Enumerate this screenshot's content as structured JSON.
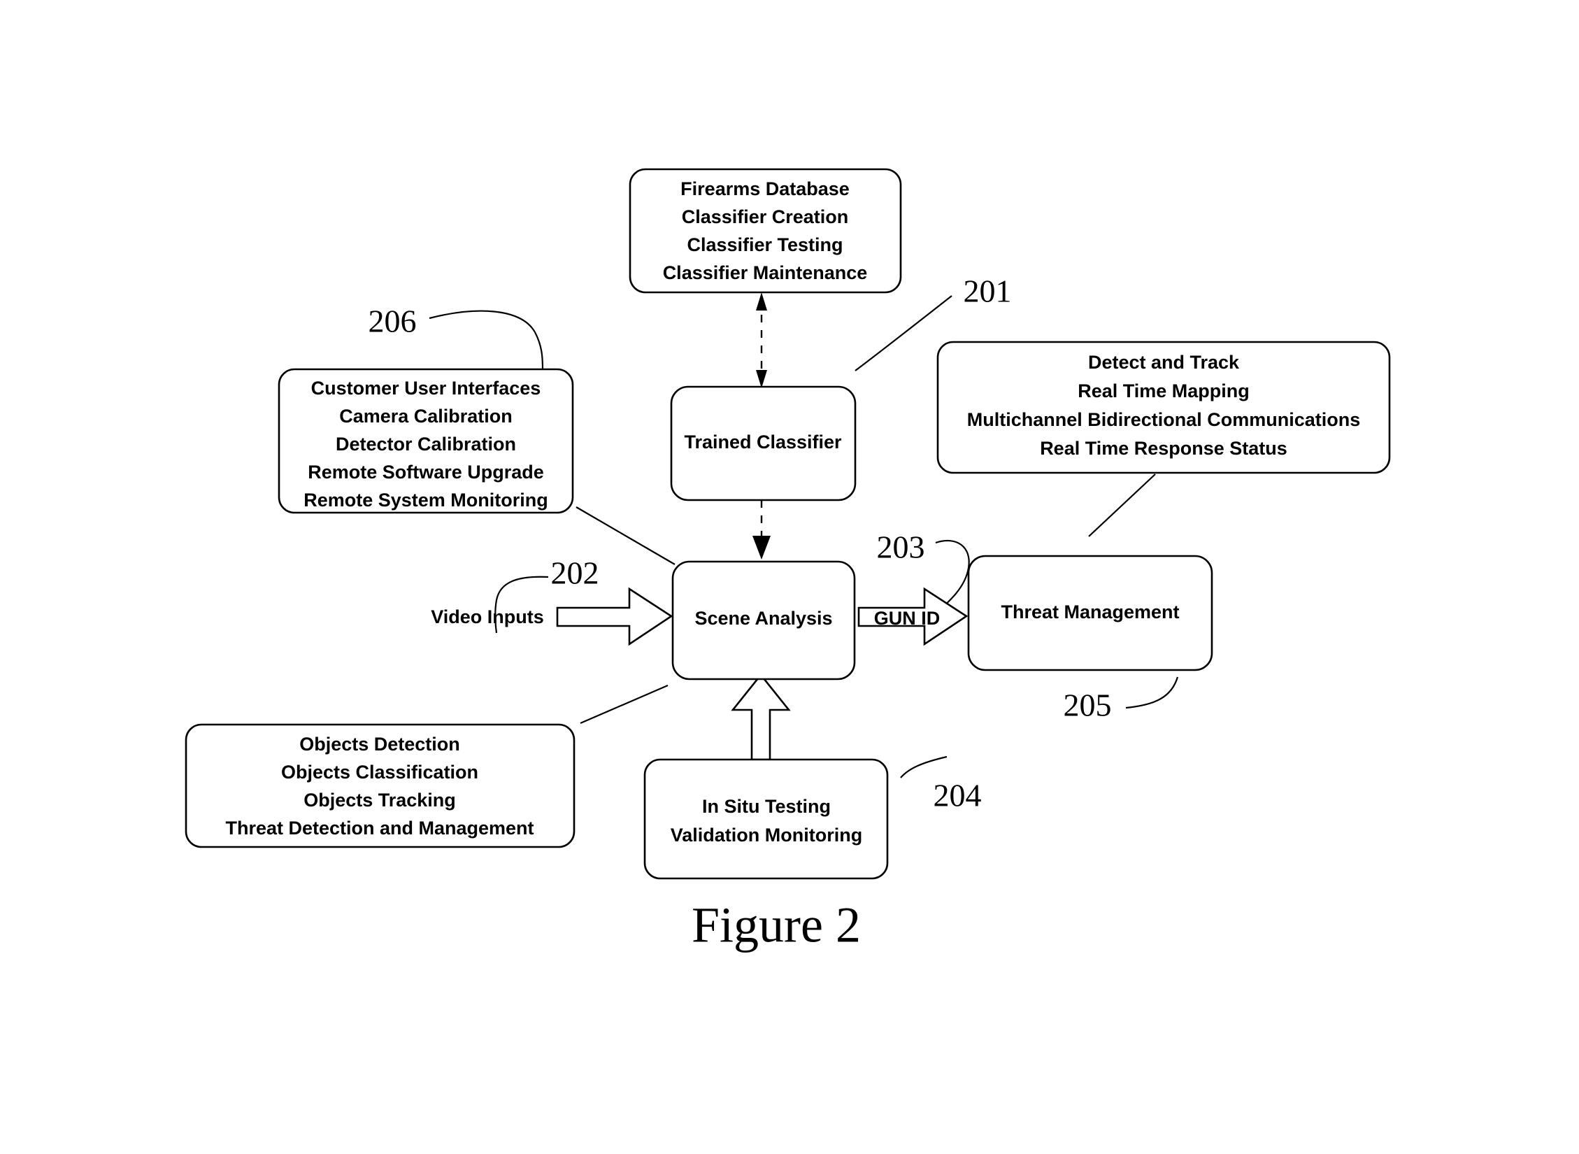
{
  "figure": {
    "caption": "Figure 2"
  },
  "nodes": {
    "firearms_database": {
      "name": "firearms-database-box",
      "lines": [
        "Firearms Database",
        "Classifier Creation",
        "Classifier Testing",
        "Classifier Maintenance"
      ]
    },
    "customer_user_interfaces": {
      "name": "customer-user-interfaces-box",
      "lines": [
        "Customer User Interfaces",
        "Camera Calibration",
        "Detector Calibration",
        "Remote Software Upgrade",
        "Remote System Monitoring"
      ]
    },
    "trained_classifier": {
      "name": "trained-classifier-box",
      "lines": [
        "Trained Classifier"
      ]
    },
    "detect_and_track": {
      "name": "detect-and-track-box",
      "lines": [
        "Detect and Track",
        "Real Time Mapping",
        "Multichannel Bidirectional Communications",
        "Real Time Response Status"
      ]
    },
    "scene_analysis": {
      "name": "scene-analysis-box",
      "lines": [
        "Scene Analysis"
      ]
    },
    "threat_management": {
      "name": "threat-management-box",
      "lines": [
        "Threat Management"
      ]
    },
    "objects_detection": {
      "name": "objects-detection-box",
      "lines": [
        "Objects Detection",
        "Objects Classification",
        "Objects Tracking",
        "Threat Detection and Management"
      ]
    },
    "in_situ_testing": {
      "name": "in-situ-testing-box",
      "lines": [
        "In Situ Testing",
        "Validation Monitoring"
      ]
    }
  },
  "flow_labels": {
    "video_inputs": "Video Inputs",
    "gun_id": "GUN ID"
  },
  "reference_numbers": {
    "ref_201": "201",
    "ref_202": "202",
    "ref_203": "203",
    "ref_204": "204",
    "ref_205": "205",
    "ref_206": "206"
  },
  "colors": {
    "ink": "#000000",
    "paper": "#ffffff"
  }
}
